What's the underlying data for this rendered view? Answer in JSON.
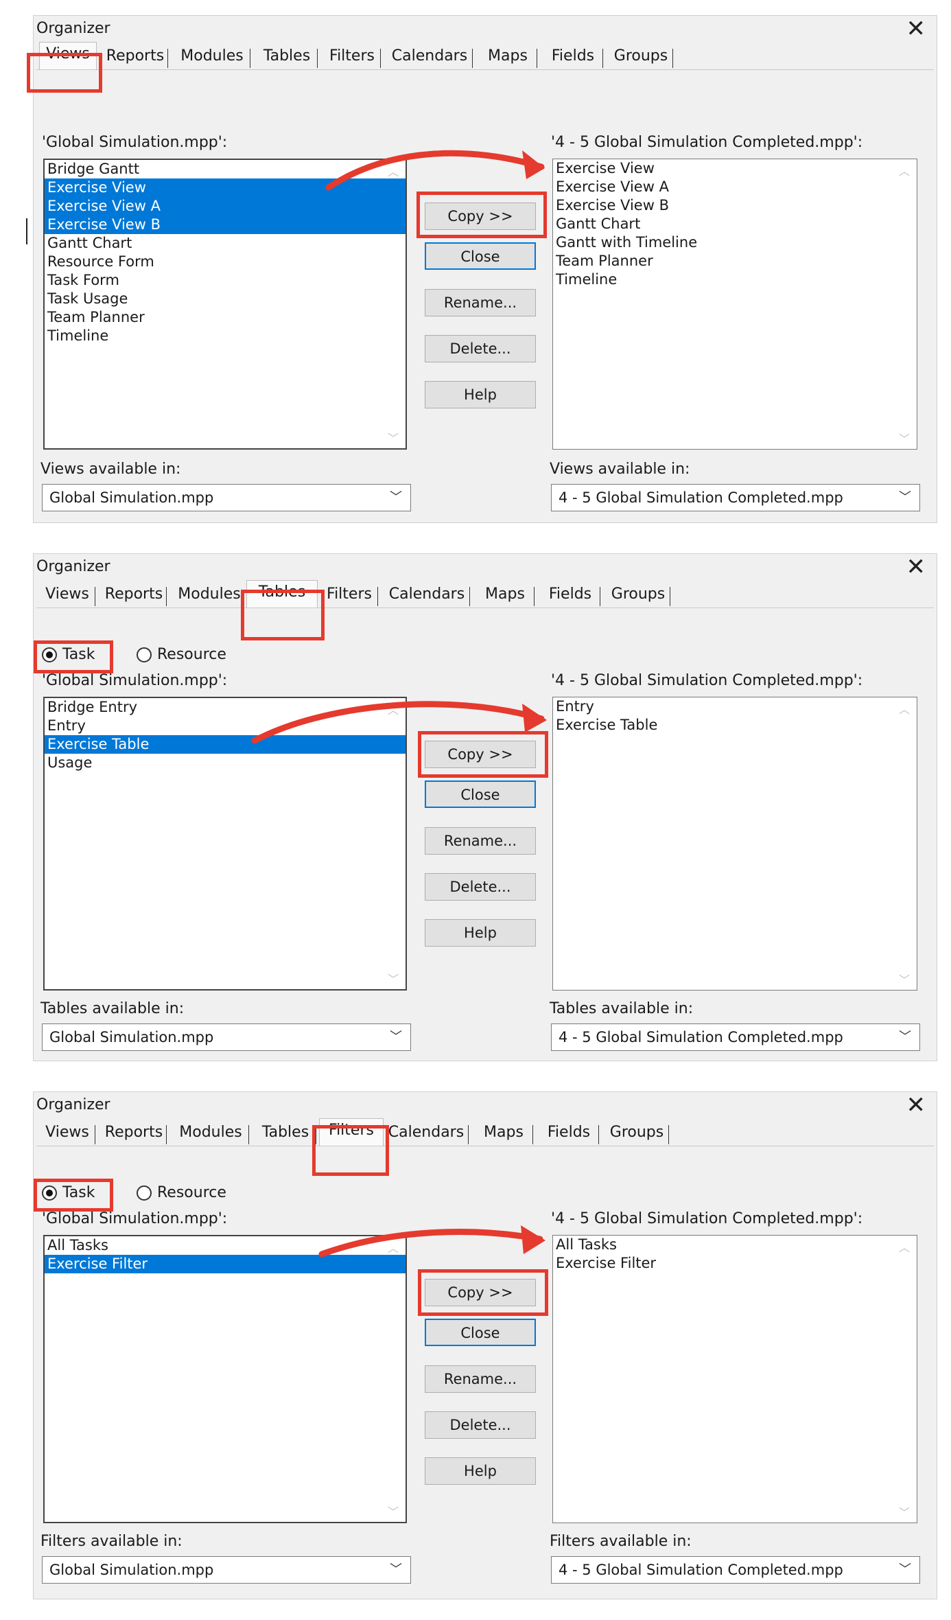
{
  "colors": {
    "selection": "#0078d7",
    "highlight": "#e53a2e",
    "dialog_bg": "#f0f0f0"
  },
  "icons": {
    "close": "close-icon",
    "dropdown": "chevron-down-icon",
    "scroll_up": "chevron-up-icon",
    "scroll_down": "chevron-down-icon"
  },
  "dialogs": [
    {
      "title": "Organizer",
      "tabs": [
        "Views",
        "Reports",
        "Modules",
        "Tables",
        "Filters",
        "Calendars",
        "Maps",
        "Fields",
        "Groups"
      ],
      "active_tab": "Views",
      "left_label": "'Global Simulation.mpp':",
      "right_label": "'4 - 5 Global Simulation Completed.mpp':",
      "left_items": [
        "Bridge Gantt",
        "Exercise View",
        "Exercise View A",
        "Exercise View B",
        "Gantt Chart",
        "Resource Form",
        "Task Form",
        "Task Usage",
        "Team Planner",
        "Timeline"
      ],
      "left_selected": [
        1,
        2,
        3
      ],
      "right_items": [
        "Exercise View",
        "Exercise View A",
        "Exercise View B",
        "Gantt Chart",
        "Gantt with Timeline",
        "Team Planner",
        "Timeline"
      ],
      "buttons": {
        "copy": "Copy >>",
        "close": "Close",
        "rename": "Rename...",
        "delete": "Delete...",
        "help": "Help"
      },
      "left_avail_label": "Views available in:",
      "right_avail_label": "Views available in:",
      "left_select": "Global Simulation.mpp",
      "right_select": "4 - 5 Global Simulation Completed.mpp"
    },
    {
      "title": "Organizer",
      "tabs": [
        "Views",
        "Reports",
        "Modules",
        "Tables",
        "Filters",
        "Calendars",
        "Maps",
        "Fields",
        "Groups"
      ],
      "active_tab": "Tables",
      "radio_task": "Task",
      "radio_resource": "Resource",
      "left_label": "'Global Simulation.mpp':",
      "right_label": "'4 - 5 Global Simulation Completed.mpp':",
      "left_items": [
        "Bridge Entry",
        "Entry",
        "Exercise Table",
        "Usage"
      ],
      "left_selected": [
        2
      ],
      "right_items": [
        "Entry",
        "Exercise Table"
      ],
      "buttons": {
        "copy": "Copy >>",
        "close": "Close",
        "rename": "Rename...",
        "delete": "Delete...",
        "help": "Help"
      },
      "left_avail_label": "Tables available in:",
      "right_avail_label": "Tables available in:",
      "left_select": "Global Simulation.mpp",
      "right_select": "4 - 5 Global Simulation Completed.mpp"
    },
    {
      "title": "Organizer",
      "tabs": [
        "Views",
        "Reports",
        "Modules",
        "Tables",
        "Filters",
        "Calendars",
        "Maps",
        "Fields",
        "Groups"
      ],
      "active_tab": "Filters",
      "radio_task": "Task",
      "radio_resource": "Resource",
      "left_label": "'Global Simulation.mpp':",
      "right_label": "'4 - 5 Global Simulation Completed.mpp':",
      "left_items": [
        "All Tasks",
        "Exercise Filter"
      ],
      "left_selected": [
        1
      ],
      "right_items": [
        "All Tasks",
        "Exercise Filter"
      ],
      "buttons": {
        "copy": "Copy >>",
        "close": "Close",
        "rename": "Rename...",
        "delete": "Delete...",
        "help": "Help"
      },
      "left_avail_label": "Filters available in:",
      "right_avail_label": "Filters available in:",
      "left_select": "Global Simulation.mpp",
      "right_select": "4 - 5 Global Simulation Completed.mpp"
    }
  ]
}
